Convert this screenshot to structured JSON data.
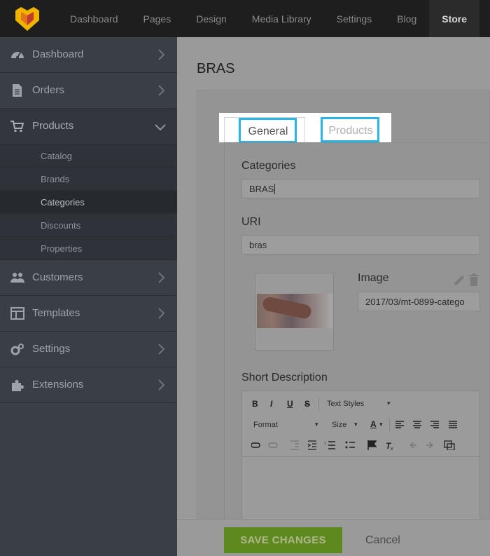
{
  "topnav": {
    "items": [
      {
        "label": "Dashboard"
      },
      {
        "label": "Pages"
      },
      {
        "label": "Design"
      },
      {
        "label": "Media Library"
      },
      {
        "label": "Settings"
      },
      {
        "label": "Blog"
      },
      {
        "label": "Store",
        "active": true
      }
    ]
  },
  "sidebar": {
    "items": [
      {
        "label": "Dashboard",
        "icon": "dashboard-icon"
      },
      {
        "label": "Orders",
        "icon": "document-icon"
      },
      {
        "label": "Products",
        "icon": "cart-icon",
        "open": true,
        "sub": [
          {
            "label": "Catalog"
          },
          {
            "label": "Brands"
          },
          {
            "label": "Categories",
            "active": true
          },
          {
            "label": "Discounts"
          },
          {
            "label": "Properties"
          }
        ]
      },
      {
        "label": "Customers",
        "icon": "users-icon"
      },
      {
        "label": "Templates",
        "icon": "template-icon"
      },
      {
        "label": "Settings",
        "icon": "gears-icon"
      },
      {
        "label": "Extensions",
        "icon": "puzzle-icon"
      }
    ]
  },
  "page": {
    "title": "BRAS"
  },
  "tabs": {
    "general": "General",
    "products": "Products",
    "highlight_color": "#29b6e6"
  },
  "form": {
    "categories_label": "Categories",
    "categories_value": "BRAS",
    "uri_label": "URI",
    "uri_value": "bras",
    "image_label": "Image",
    "image_value": "2017/03/mt-0899-catego",
    "short_desc_label": "Short Description"
  },
  "editor": {
    "bold": "B",
    "italic": "I",
    "underline": "U",
    "strike": "S",
    "text_styles": "Text Styles",
    "format": "Format",
    "size": "Size",
    "font_color": "A"
  },
  "footer": {
    "save": "SAVE CHANGES",
    "cancel": "Cancel",
    "save_color": "#5c8a1f"
  }
}
